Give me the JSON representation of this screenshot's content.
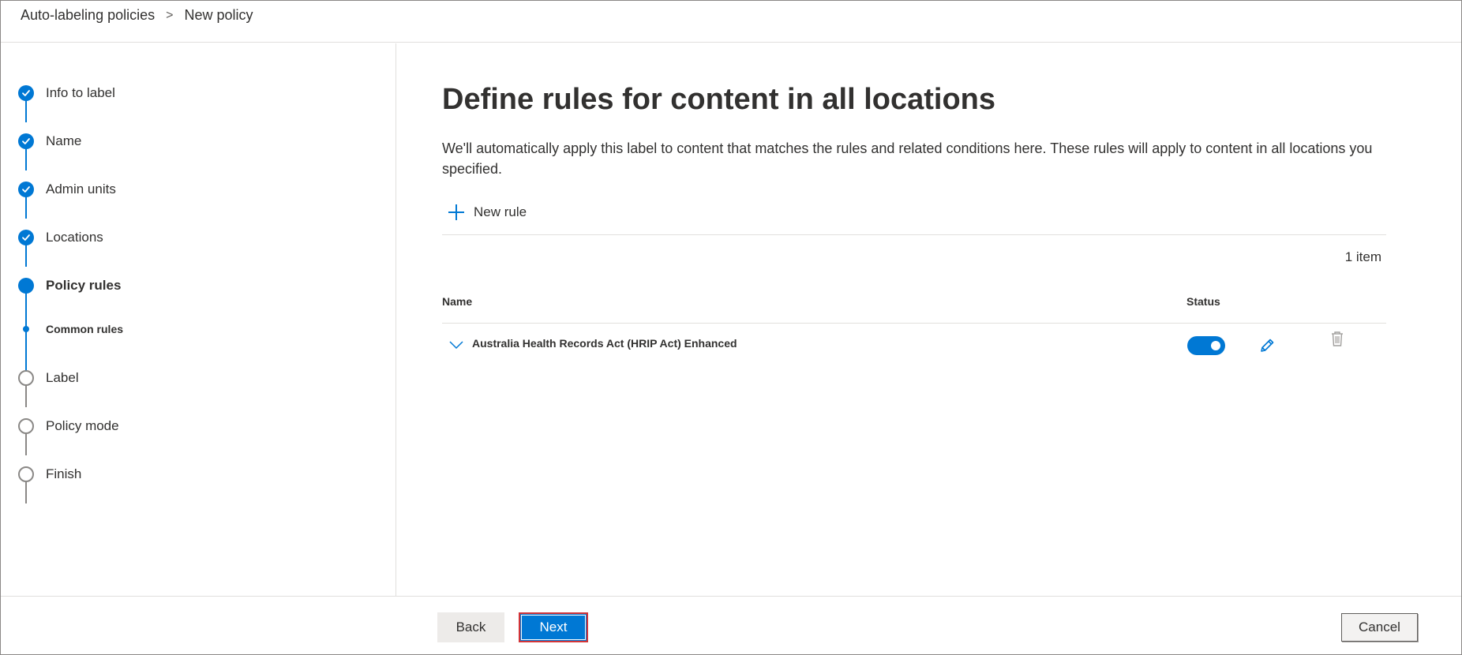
{
  "breadcrumb": {
    "parent": "Auto-labeling policies",
    "separator": ">",
    "current": "New policy"
  },
  "steps": [
    {
      "label": "Info to label",
      "state": "done"
    },
    {
      "label": "Name",
      "state": "done"
    },
    {
      "label": "Admin units",
      "state": "done"
    },
    {
      "label": "Locations",
      "state": "done"
    },
    {
      "label": "Policy rules",
      "state": "current"
    },
    {
      "label": "Common rules",
      "state": "current-substep"
    },
    {
      "label": "Label",
      "state": "todo"
    },
    {
      "label": "Policy mode",
      "state": "todo"
    },
    {
      "label": "Finish",
      "state": "todo"
    }
  ],
  "main": {
    "title": "Define rules for content in all locations",
    "description": "We'll automatically apply this label to content that matches the rules and related conditions here. These rules will apply to content in all locations you specified.",
    "new_rule_label": "New rule",
    "item_count": "1 item",
    "columns": {
      "name": "Name",
      "status": "Status"
    },
    "rules": [
      {
        "name": "Australia Health Records Act (HRIP Act) Enhanced",
        "enabled": true
      }
    ]
  },
  "footer": {
    "back_label": "Back",
    "next_label": "Next",
    "cancel_label": "Cancel"
  },
  "colors": {
    "accent": "#0078d4",
    "highlight_border": "#d13438"
  }
}
